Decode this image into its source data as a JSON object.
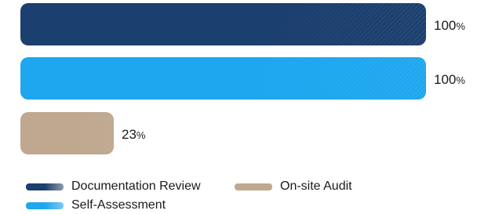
{
  "chart_data": {
    "type": "bar",
    "orientation": "horizontal",
    "categories": [
      "Documentation Review",
      "Self-Assessment",
      "On-site Audit"
    ],
    "values": [
      100,
      100,
      23
    ],
    "unit": "%",
    "xlim": [
      0,
      100
    ],
    "colors": [
      "#1b3f6e",
      "#1ea7ee",
      "#bfa88f"
    ],
    "grid": false,
    "legend_position": "bottom-left"
  },
  "legend": {
    "items": [
      {
        "label": "Documentation Review",
        "color": "#1b3f6e"
      },
      {
        "label": "On-site Audit",
        "color": "#bfa88f"
      },
      {
        "label": "Self-Assessment",
        "color": "#1ea7ee"
      }
    ]
  }
}
